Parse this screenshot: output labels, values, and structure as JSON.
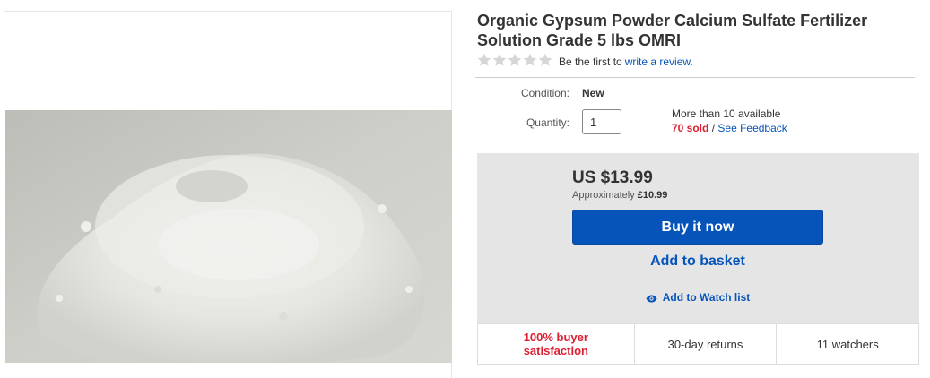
{
  "listing": {
    "title": "Organic Gypsum Powder Calcium Sulfate Fertilizer Solution Grade 5 lbs OMRI",
    "rating_stars": 0,
    "rating_max": 5,
    "review_prompt": "Be the first to",
    "review_link": "write a review."
  },
  "details": {
    "condition_label": "Condition:",
    "condition_value": "New",
    "quantity_label": "Quantity:",
    "quantity_value": "1",
    "availability": "More than 10 available",
    "sold": "70 sold",
    "separator": "/",
    "feedback_link": "See Feedback"
  },
  "purchase": {
    "price": "US $13.99",
    "approx_prefix": "Approximately",
    "approx_value": "£10.99",
    "buy_label": "Buy it now",
    "basket_label": "Add to basket",
    "watch_label": "Add to Watch list",
    "watch_icon": "eye-icon"
  },
  "trust": {
    "satisfaction": "100% buyer satisfaction",
    "returns": "30-day returns",
    "watchers": "11 watchers"
  },
  "colors": {
    "link": "#0654ba",
    "button": "#0654ba",
    "alert": "#dd1e31",
    "buybox_bg": "#e5e5e5",
    "star_empty": "#d6d6d6"
  }
}
